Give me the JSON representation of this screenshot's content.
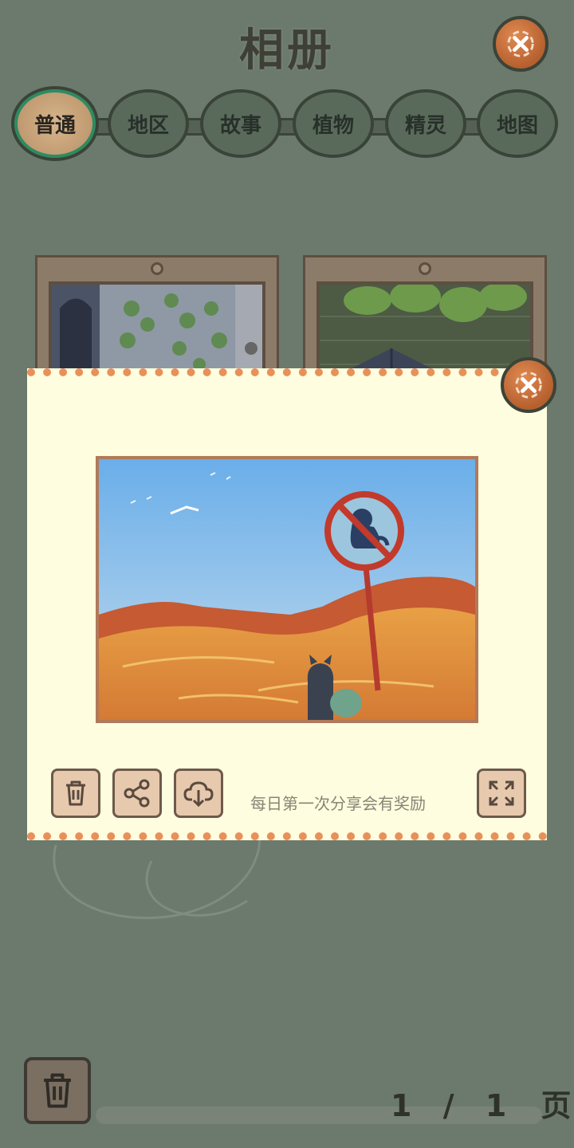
{
  "header": {
    "title": "相册",
    "close_icon": "close-icon"
  },
  "tabs": [
    {
      "label": "普通",
      "active": true
    },
    {
      "label": "地区",
      "active": false
    },
    {
      "label": "故事",
      "active": false
    },
    {
      "label": "植物",
      "active": false
    },
    {
      "label": "精灵",
      "active": false
    },
    {
      "label": "地图",
      "active": false
    }
  ],
  "dialog": {
    "photo_subject": "desert-no-pets-sign",
    "hint": "每日第一次分享会有奖励",
    "actions": [
      "trash-icon",
      "share-icon",
      "cloud-download-icon"
    ],
    "expand_icon": "expand-icon",
    "close_icon": "close-icon"
  },
  "pager": {
    "current": "1",
    "separator": "/",
    "total": "1",
    "unit": "页"
  },
  "colors": {
    "background": "#6b7a6c",
    "dialog": "#fffddf",
    "accent": "#e9905a",
    "active_tab_ring": "#2f8a62"
  }
}
